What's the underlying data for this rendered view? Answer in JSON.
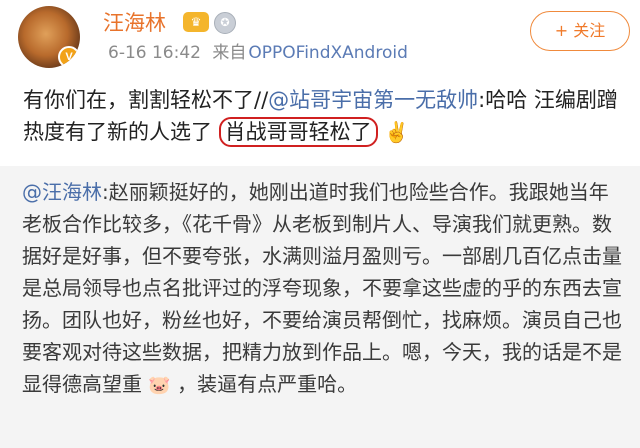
{
  "user": {
    "name": "汪海林",
    "avatar_badge": "V",
    "vip_icon": "crown-icon",
    "medal_icon": "medal-icon",
    "time": "6-16 16:42",
    "from_label": "来自",
    "device": "OPPOFindXAndroid"
  },
  "follow": {
    "label": "+ 关注"
  },
  "post": {
    "text_1": "有你们在，割割轻松不了//",
    "mention": "@站哥宇宙第一无敌帅",
    "text_2": ":哈哈 汪编剧蹭热度有了新的人选了",
    "circled": "肖战哥哥轻松了",
    "emoji": "✌️"
  },
  "repost": {
    "mention": "@汪海林",
    "text": ":赵丽颖挺好的，她刚出道时我们也险些合作。我跟她当年老板合作比较多，《花千骨》从老板到制片人、导演我们就更熟。数据好是好事，但不要夸张，水满则溢月盈则亏。一部剧几百亿点击量是总局领导也点名批评过的浮夸现象，不要拿这些虚的乎的东西去宣扬。团队也好，粉丝也好，不要给演员帮倒忙，找麻烦。演员自己也要客观对待这些数据，把精力放到作品上。嗯，今天，我的话是不是显得德高望重",
    "emoji": "🐷",
    "text_end": "，装逼有点严重哈。"
  },
  "colors": {
    "name": "#e8732b",
    "mention": "#4a6ea9",
    "circle": "#d02020",
    "repost_bg": "#f4f4f4"
  }
}
